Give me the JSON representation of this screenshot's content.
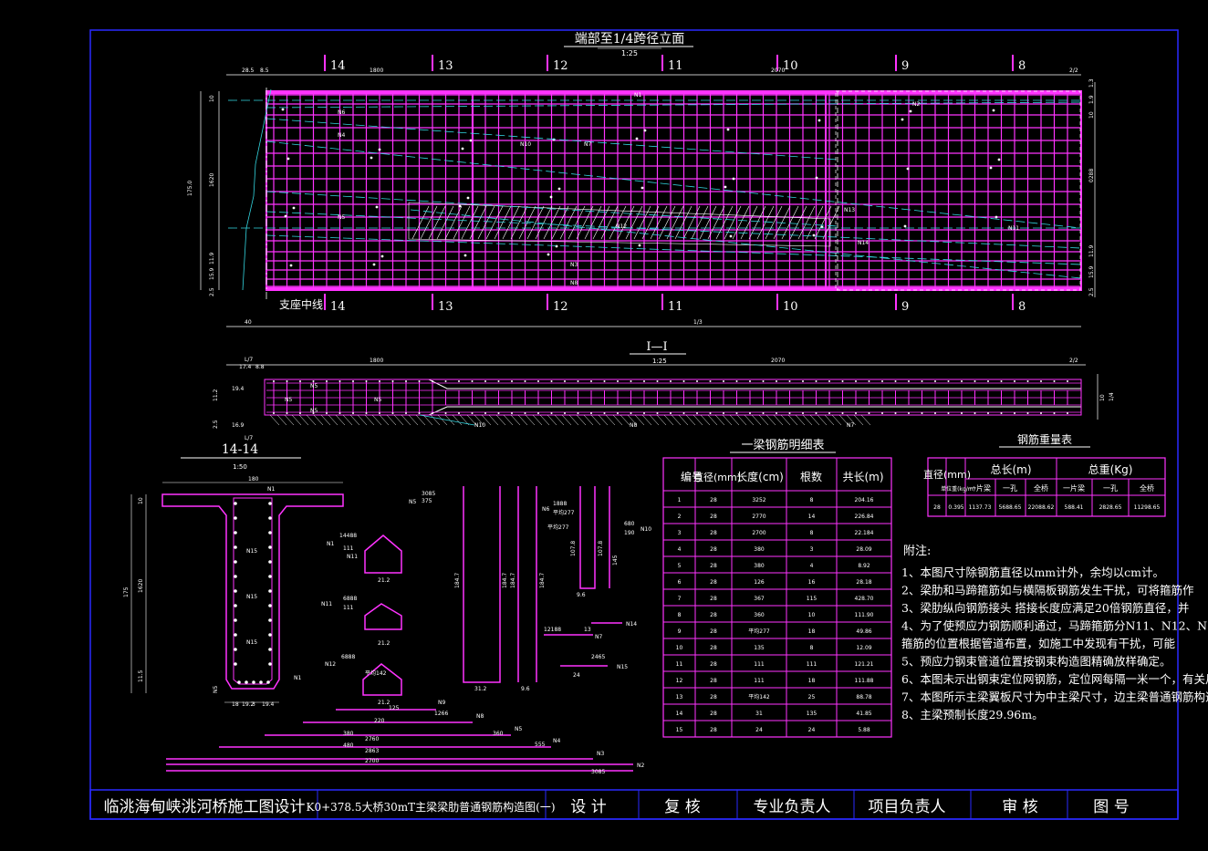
{
  "colors": {
    "background": "#000000",
    "frame": "#2a2aff",
    "rebar": "#ff33ff",
    "dim": "#ffffff",
    "centerline": "#33d6e0",
    "section_cut": "#ffffff"
  },
  "elevation": {
    "title": "端部至1/4跨径立面",
    "scale": "1:25",
    "section_marks": [
      "14",
      "13",
      "12",
      "11",
      "10",
      "9",
      "8"
    ],
    "support_label": "支座中线",
    "dims_top": [
      "28.5",
      "8.5",
      "1800",
      "2070",
      "2/2"
    ],
    "dims_bottom": [
      "40",
      "1/3"
    ],
    "dims_left": [
      "175.0",
      "1620",
      "10",
      "11.9",
      "15.9",
      "2.5"
    ],
    "dims_right": [
      "1.3",
      "1.9",
      "10",
      "0288",
      "11.9",
      "15.9",
      "2.5"
    ],
    "bar_labels": [
      "N1",
      "N2",
      "N3",
      "N4",
      "N5",
      "N6",
      "N7",
      "N8",
      "N10",
      "N11",
      "N13",
      "N12",
      "N14"
    ]
  },
  "plan": {
    "title": "I—I",
    "scale": "1:25",
    "dims_top": [
      "1800",
      "2070",
      "2/2"
    ],
    "dims_left": [
      "17.4",
      "L/7",
      "8.8",
      "19.4",
      "11.2",
      "2.5",
      "16.9",
      "L/7"
    ],
    "dims_right": [
      "10",
      "1/4"
    ],
    "bar_labels": [
      "N5",
      "N5",
      "N5",
      "N5",
      "N10",
      "N8",
      "N7"
    ]
  },
  "section": {
    "title": "14-14",
    "scale": "1:50",
    "dims": [
      "180",
      "175",
      "1620",
      "10",
      "11.5",
      "18",
      "19.2",
      "3",
      "19.4"
    ],
    "bar_labels": [
      "N1",
      "N15",
      "N15",
      "N15",
      "N1",
      "N5"
    ]
  },
  "details": {
    "labels": [
      "N1",
      "N11",
      "N12",
      "N13",
      "N9",
      "N8",
      "N5",
      "N4",
      "N3",
      "N2",
      "N1",
      "N7",
      "N14",
      "N15",
      "N6",
      "N10"
    ],
    "values": [
      "3085",
      "375",
      "14488",
      "111",
      "6888",
      "111",
      "6888",
      "21.2",
      "21.2",
      "21.2",
      "184.7",
      "184.7",
      "184.7",
      "184.7",
      "31.2",
      "9.6",
      "1888",
      "1266",
      "2760",
      "2863",
      "3085",
      "125",
      "220",
      "380",
      "480",
      "2700",
      "555",
      "13",
      "24",
      "2465",
      "360",
      "9.6",
      "107.8",
      "107.8",
      "126.9",
      "145",
      "12188",
      "2465",
      "6888",
      "1866",
      "2/2",
      "680",
      "190"
    ],
    "notes_inline": [
      "平均277",
      "平均277",
      "平均142"
    ]
  },
  "rebar_table": {
    "title": "一梁钢筋明细表",
    "headers": [
      "编号",
      "直径(mm)",
      "长度(cm)",
      "根数",
      "共长(m)"
    ],
    "rows": [
      [
        "1",
        "28",
        "3252",
        "8",
        "204.16"
      ],
      [
        "2",
        "28",
        "2770",
        "14",
        "226.84"
      ],
      [
        "3",
        "28",
        "2700",
        "8",
        "22.184"
      ],
      [
        "4",
        "28",
        "380",
        "3",
        "28.09"
      ],
      [
        "5",
        "28",
        "380",
        "4",
        "8.92"
      ],
      [
        "6",
        "28",
        "126",
        "16",
        "28.18"
      ],
      [
        "7",
        "28",
        "367",
        "115",
        "428.70"
      ],
      [
        "8",
        "28",
        "360",
        "10",
        "111.90"
      ],
      [
        "9",
        "28",
        "平均277",
        "18",
        "49.86"
      ],
      [
        "10",
        "28",
        "135",
        "8",
        "12.09"
      ],
      [
        "11",
        "28",
        "111",
        "111",
        "121.21"
      ],
      [
        "12",
        "28",
        "111",
        "18",
        "111.88"
      ],
      [
        "13",
        "28",
        "平均142",
        "25",
        "88.78"
      ],
      [
        "14",
        "28",
        "31",
        "135",
        "41.85"
      ],
      [
        "15",
        "28",
        "24",
        "24",
        "5.88"
      ]
    ]
  },
  "weight_table": {
    "title": "钢筋重量表",
    "headers": [
      "直径(mm)",
      "单位重(kg/m)",
      "总长(m)",
      "总重(Kg)"
    ],
    "sub_headers": [
      "一片梁",
      "一孔",
      "全桥",
      "一片梁",
      "一孔",
      "全桥"
    ],
    "row": [
      "28",
      "0.395",
      "1137.73",
      "5688.65",
      "22088.62",
      "588.41",
      "2828.65",
      "11298.65"
    ]
  },
  "notes": {
    "title": "附注:",
    "items": [
      "1、本图尺寸除钢筋直径以mm计外，余均以cm计。",
      "2、梁肋和马蹄箍筋如与横隔板钢筋发生干扰，可将箍筋作",
      "3、梁肋纵向钢筋接头 搭接长度应满足20倍钢筋直径，并",
      "4、为了使预应力钢筋顺利通过，马蹄箍筋分N11、N12、N13三",
      "    箍筋的位置根据管道布置，如施工中发现有干扰，可能",
      "5、预应力钢束管道位置按钢束构造图精确放样确定。",
      "6、本图未示出钢束定位网钢筋，定位网每隔一米一个，有关尺寸相见定",
      "7、本图所示主梁翼板尺寸为中主梁尺寸，边主梁普通钢筋构造",
      "8、主梁预制长度29.96m。"
    ]
  },
  "title_block": {
    "project": "临洮海甸峡洮河桥施工图设计",
    "drawing": "K0+378.5大桥30mT主梁梁肋普通钢筋构造图(一)",
    "cells": [
      "设 计",
      "复 核",
      "专业负责人",
      "项目负责人",
      "审 核",
      "图 号"
    ]
  }
}
